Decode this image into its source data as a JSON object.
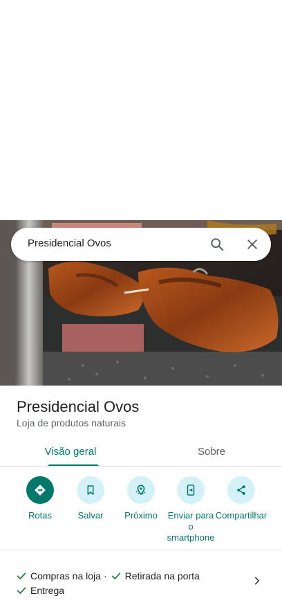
{
  "search": {
    "query": "Presidencial Ovos",
    "search_icon": "search-icon",
    "close_icon": "close-icon"
  },
  "place": {
    "title": "Presidencial Ovos",
    "category": "Loja de produtos naturais"
  },
  "tabs": [
    {
      "label": "Visão geral",
      "selected": true
    },
    {
      "label": "Sobre",
      "selected": false
    }
  ],
  "actions": [
    {
      "label": "Rotas",
      "icon": "directions-icon"
    },
    {
      "label": "Salvar",
      "icon": "bookmark-icon"
    },
    {
      "label": "Próximo",
      "icon": "nearby-icon"
    },
    {
      "label": "Enviar para o smartphone",
      "icon": "send-to-phone-icon"
    },
    {
      "label": "Compartilhar",
      "icon": "share-icon"
    }
  ],
  "services": {
    "items": [
      "Compras na loja",
      "Retirada na porta",
      "Entrega"
    ],
    "separator": "·",
    "check_icon": "check-icon",
    "chevron_icon": "chevron-right-icon"
  },
  "colors": {
    "accent": "#00796b",
    "action_bg": "#d4f1f7",
    "check": "#188038",
    "text_primary": "#202124",
    "text_secondary": "#5f6368"
  }
}
